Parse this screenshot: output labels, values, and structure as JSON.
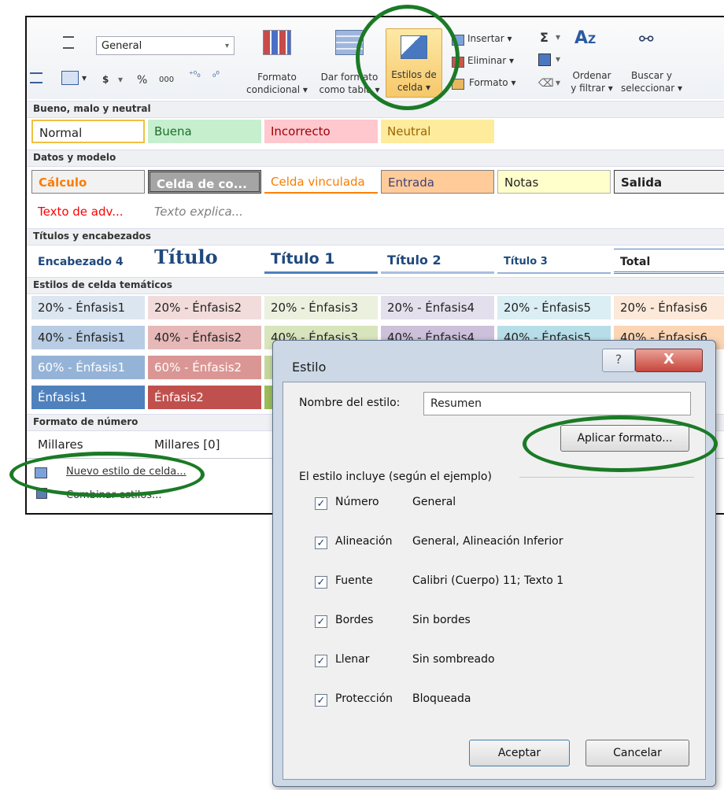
{
  "ribbon": {
    "number_format": "General",
    "currency": "$",
    "percent": "%",
    "thousands": "000",
    "formato_condicional": [
      "Formato",
      "condicional"
    ],
    "dar_formato": [
      "Dar formato",
      "como tabla"
    ],
    "estilos_celda": [
      "Estilos de",
      "celda"
    ],
    "insertar": "Insertar",
    "eliminar": "Eliminar",
    "formato": "Formato",
    "ordenar": [
      "Ordenar",
      "y filtrar"
    ],
    "buscar": [
      "Buscar y",
      "seleccionar"
    ],
    "sigma": "Σ"
  },
  "gallery": {
    "sections": {
      "bueno": "Bueno, malo y neutral",
      "datos": "Datos y modelo",
      "titulos": "Títulos y encabezados",
      "tematicos": "Estilos de celda temáticos",
      "numero": "Formato de número"
    },
    "bueno_row": [
      "Normal",
      "Buena",
      "Incorrecto",
      "Neutral"
    ],
    "datos_row": [
      "Cálculo",
      "Celda de co...",
      "Celda vinculada",
      "Entrada",
      "Notas",
      "Salida"
    ],
    "datos_row2": [
      "Texto de adv...",
      "Texto explica..."
    ],
    "titulos_row": [
      "Encabezado 4",
      "Título",
      "Título 1",
      "Título 2",
      "Título 3",
      "Total"
    ],
    "enfasis20": [
      "20% - Énfasis1",
      "20% - Énfasis2",
      "20% - Énfasis3",
      "20% - Énfasis4",
      "20% - Énfasis5",
      "20% - Énfasis6"
    ],
    "enfasis40": [
      "40% - Énfasis1",
      "40% - Énfasis2",
      "40% - Énfasis3",
      "40% - Énfasis4",
      "40% - Énfasis5",
      "40% - Énfasis6"
    ],
    "enfasis60": [
      "60% - Énfasis1",
      "60% - Énfasis2"
    ],
    "enfasis": [
      "Énfasis1",
      "Énfasis2"
    ],
    "numero_row": [
      "Millares",
      "Millares [0]"
    ],
    "nuevo_estilo": "Nuevo estilo de celda...",
    "combinar": "Combinar estilos..."
  },
  "dialog": {
    "title": "Estilo",
    "help": "?",
    "close": "X",
    "nombre_label": "Nombre del estilo:",
    "nombre_value": "Resumen",
    "aplicar": "Aplicar formato...",
    "incluye": "El estilo incluye (según el ejemplo)",
    "items": [
      {
        "label": "Número",
        "value": "General"
      },
      {
        "label": "Alineación",
        "value": "General, Alineación Inferior"
      },
      {
        "label": "Fuente",
        "value": "Calibri (Cuerpo) 11; Texto 1"
      },
      {
        "label": "Bordes",
        "value": "Sin bordes"
      },
      {
        "label": "Llenar",
        "value": "Sin sombreado"
      },
      {
        "label": "Protección",
        "value": "Bloqueada"
      }
    ],
    "aceptar": "Aceptar",
    "cancelar": "Cancelar",
    "check": "✓"
  },
  "colors": {
    "highlight_circle": "#1b7a26",
    "buena_bg": "#c6efce",
    "incorrecto_bg": "#ffc7ce",
    "neutral_bg": "#ffeb9c",
    "accent1": "#4f81bd",
    "accent2": "#c0504d"
  }
}
